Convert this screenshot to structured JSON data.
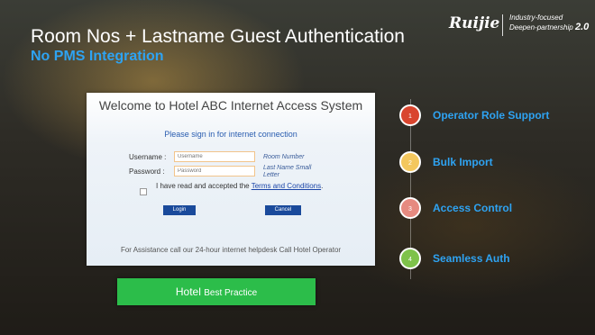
{
  "header": {
    "title": "Room Nos + Lastname Guest Authentication",
    "subtitle": "No PMS Integration"
  },
  "brand": {
    "logo": "Ruijie",
    "tagline1": "Industry-focused",
    "tagline2": "Deepen-partnership",
    "tagline_version": "2.0"
  },
  "portal": {
    "welcome": "Welcome to Hotel ABC Internet Access System",
    "signin": "Please sign in for internet connection",
    "username_label": "Username :",
    "username_placeholder": "Username",
    "username_hint": "Room Number",
    "password_label": "Password :",
    "password_placeholder": "Password",
    "password_hint": "Last Name Small Letter",
    "accept_text": "I have read and accepted the ",
    "accept_link": "Terms and Conditions",
    "accept_end": ".",
    "login_label": "Login",
    "cancel_label": "Cancel",
    "assistance": "For Assistance call our 24-hour internet helpdesk Call Hotel Operator"
  },
  "best_practice": {
    "label_main": "Hotel",
    "label_sub": "Best Practice"
  },
  "features": [
    {
      "number": "1",
      "label": "Operator Role Support",
      "color": "#d9452e"
    },
    {
      "number": "2",
      "label": "Bulk Import",
      "color": "#f3c75e"
    },
    {
      "number": "3",
      "label": "Access Control",
      "color": "#e68a80"
    },
    {
      "number": "4",
      "label": "Seamless Auth",
      "color": "#7ec24a"
    }
  ],
  "colors": {
    "accent": "#2ea3f2",
    "button": "#1a4a9b",
    "best_practice": "#2cbd4a"
  }
}
